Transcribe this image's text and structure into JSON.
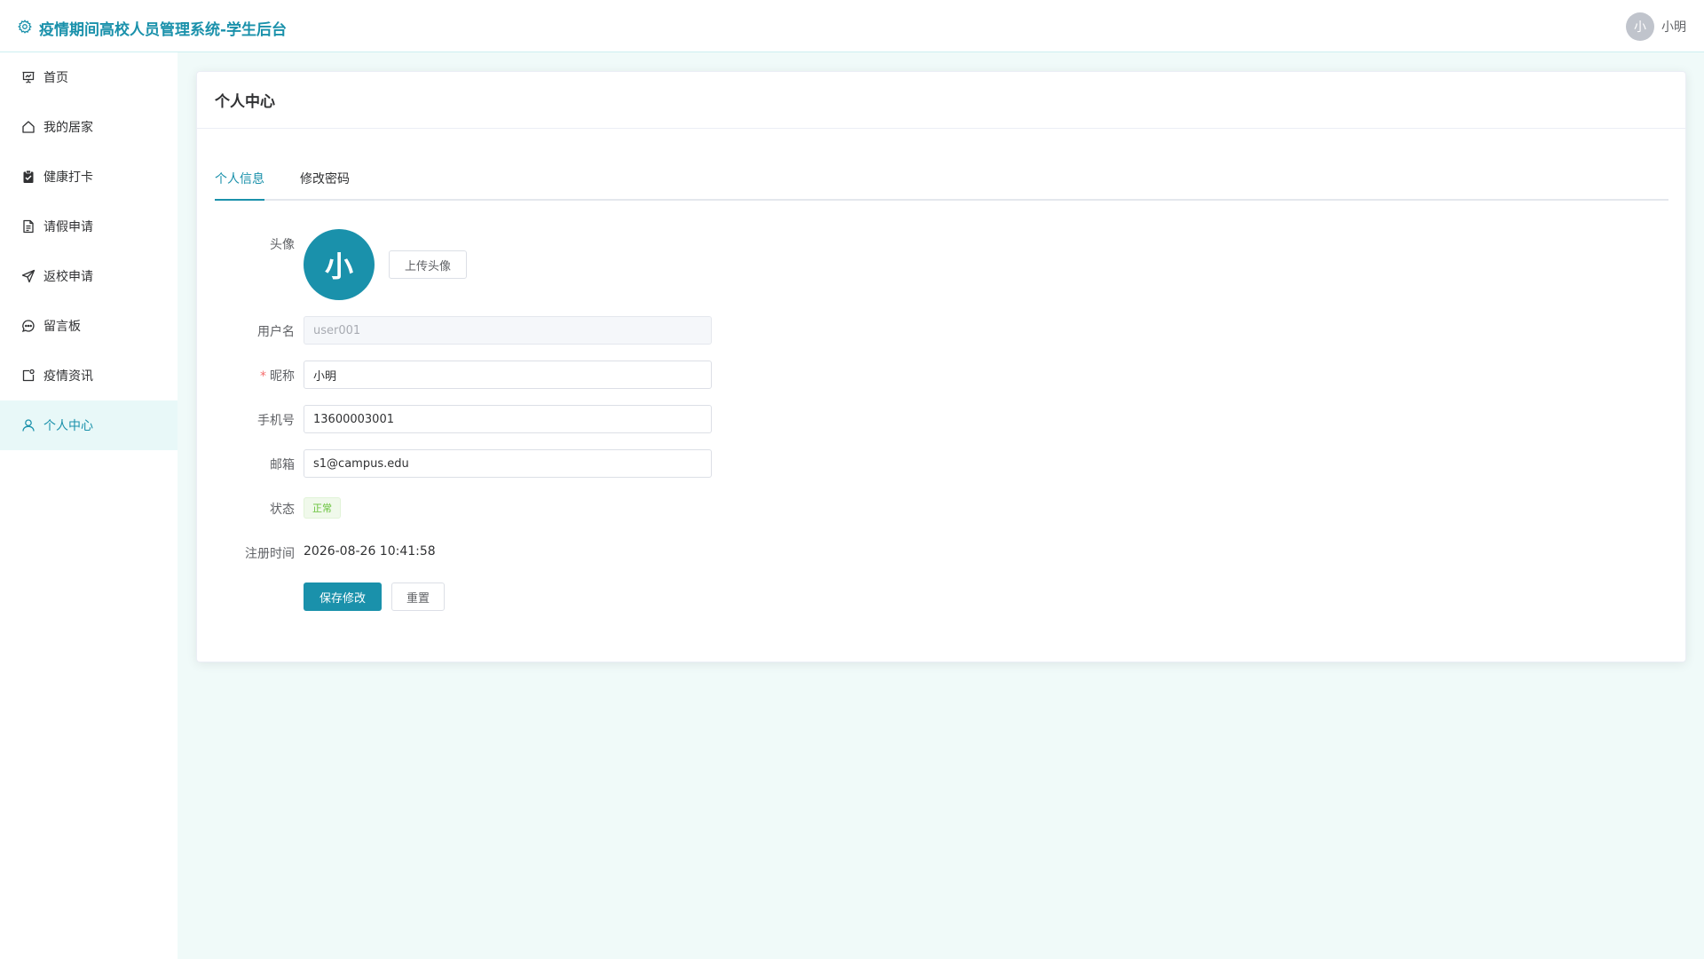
{
  "header": {
    "title": "疫情期间高校人员管理系统-学生后台",
    "logo_icon": "gear-icon",
    "user": {
      "avatar_text": "小",
      "name": "小明"
    }
  },
  "sidebar": {
    "items": [
      {
        "label": "首页",
        "icon": "presentation-icon",
        "active": false
      },
      {
        "label": "我的居家",
        "icon": "home-icon",
        "active": false
      },
      {
        "label": "健康打卡",
        "icon": "clipboard-check-icon",
        "active": false
      },
      {
        "label": "请假申请",
        "icon": "document-icon",
        "active": false
      },
      {
        "label": "返校申请",
        "icon": "send-icon",
        "active": false
      },
      {
        "label": "留言板",
        "icon": "chat-icon",
        "active": false
      },
      {
        "label": "疫情资讯",
        "icon": "news-icon",
        "active": false
      },
      {
        "label": "个人中心",
        "icon": "user-icon",
        "active": true
      }
    ]
  },
  "main": {
    "card_title": "个人中心",
    "tabs": [
      {
        "label": "个人信息",
        "active": true
      },
      {
        "label": "修改密码",
        "active": false
      }
    ],
    "form": {
      "avatar_label": "头像",
      "avatar_text": "小",
      "upload_button": "上传头像",
      "username_label": "用户名",
      "username_value": "user001",
      "nickname_label": "昵称",
      "nickname_required": "*",
      "nickname_value": "小明",
      "phone_label": "手机号",
      "phone_value": "13600003001",
      "email_label": "邮箱",
      "email_value": "s1@campus.edu",
      "status_label": "状态",
      "status_value": "正常",
      "register_label": "注册时间",
      "register_value": "2026-08-26 10:41:58",
      "save_button": "保存修改",
      "reset_button": "重置"
    }
  },
  "colors": {
    "primary": "#1a91ab",
    "active_menu_bg": "#e8f8f8",
    "page_bg": "#f0faf9",
    "success": "#67c23a",
    "required": "#f56c6c"
  }
}
